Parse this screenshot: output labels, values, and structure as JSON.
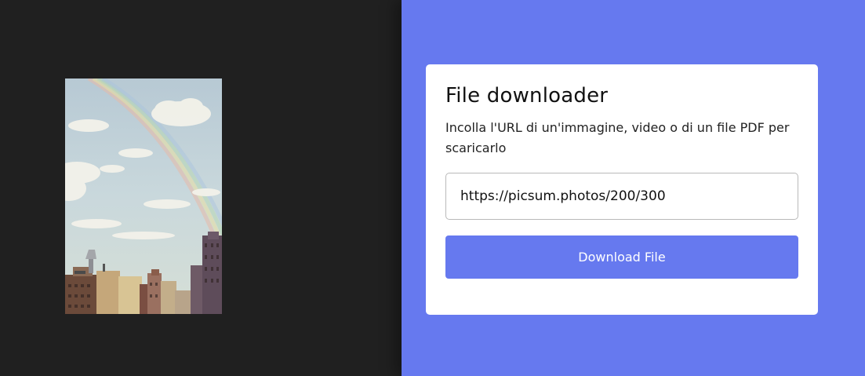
{
  "colors": {
    "left_background": "#202020",
    "accent": "#6679ef",
    "card_background": "#ffffff"
  },
  "preview": {
    "icon": "city-skyline-rainbow-image"
  },
  "card": {
    "title": "File downloader",
    "description": "Incolla l'URL di un'immagine, video o di un file PDF per scaricarlo",
    "url_input": {
      "value": "https://picsum.photos/200/300",
      "placeholder": ""
    },
    "button_label": "Download File"
  }
}
